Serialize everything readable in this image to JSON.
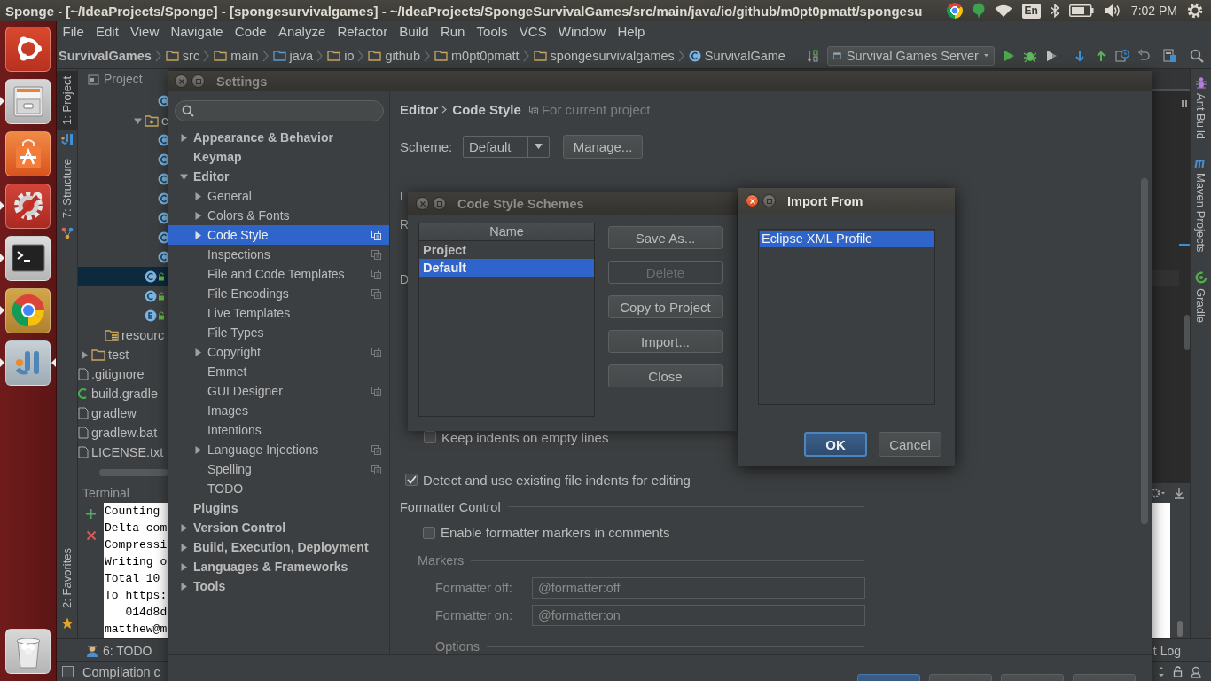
{
  "top_panel": {
    "title": "Sponge - [~/IdeaProjects/Sponge] - [spongesurvivalgames] - ~/IdeaProjects/SpongeSurvivalGames/src/main/java/io/github/m0pt0pmatt/spongesu",
    "keyboard": "En",
    "clock": "7:02 PM"
  },
  "launcher": {
    "apps": [
      {
        "kind": "dash",
        "running": false,
        "focused": false
      },
      {
        "kind": "files",
        "running": true,
        "focused": false
      },
      {
        "kind": "software",
        "running": false,
        "focused": false
      },
      {
        "kind": "settings",
        "running": true,
        "focused": false
      },
      {
        "kind": "terminal",
        "running": true,
        "focused": false
      },
      {
        "kind": "chrome",
        "running": true,
        "focused": false
      },
      {
        "kind": "intellij",
        "running": true,
        "focused": true
      }
    ]
  },
  "menu": [
    "File",
    "Edit",
    "View",
    "Navigate",
    "Code",
    "Analyze",
    "Refactor",
    "Build",
    "Run",
    "Tools",
    "VCS",
    "Window",
    "Help"
  ],
  "navbar": {
    "crumbs": [
      {
        "kind": "module",
        "label": "SurvivalGames"
      },
      {
        "kind": "folder",
        "label": "src"
      },
      {
        "kind": "folder",
        "label": "main"
      },
      {
        "kind": "source-folder",
        "label": "java"
      },
      {
        "kind": "folder",
        "label": "io"
      },
      {
        "kind": "folder",
        "label": "github"
      },
      {
        "kind": "folder",
        "label": "m0pt0pmatt"
      },
      {
        "kind": "folder",
        "label": "spongesurvivalgames"
      },
      {
        "kind": "class",
        "label": "SurvivalGame"
      }
    ],
    "run_config": "Survival Games Server"
  },
  "left_strip": {
    "top": [
      {
        "kind": "project",
        "label": "1: Project",
        "selected": true
      },
      {
        "kind": "structure",
        "label": "7: Structure",
        "selected": false
      }
    ],
    "bottom": [
      {
        "kind": "favorites",
        "label": "2: Favorites",
        "selected": false
      }
    ]
  },
  "right_strip": [
    {
      "kind": "ant",
      "label": "Ant Build"
    },
    {
      "kind": "maven",
      "label": "Maven Projects"
    },
    {
      "kind": "gradle",
      "label": "Gradle"
    }
  ],
  "project": {
    "title": "Project",
    "tree": [
      {
        "children": [
          {
            "children": [
              {
                "children": [
                  {
                    "children": [
                      {
                        "children": [
                          {
                            "children": [
                              {
                                "kind": "class",
                                "selected": false
                              }
                            ]
                          },
                          {
                            "kind": "package",
                            "label": "e",
                            "expanded": true,
                            "selected": false,
                            "children": [
                              {
                                "kind": "class",
                                "selected": false
                              },
                              {
                                "kind": "class",
                                "selected": false
                              },
                              {
                                "kind": "class",
                                "selected": false
                              },
                              {
                                "kind": "class",
                                "selected": false
                              },
                              {
                                "kind": "class",
                                "selected": false
                              },
                              {
                                "kind": "class",
                                "selected": false
                              },
                              {
                                "kind": "class",
                                "selected": false
                              }
                            ]
                          },
                          {
                            "kind": "class-locked",
                            "selected": true
                          },
                          {
                            "kind": "class-locked",
                            "selected": false
                          },
                          {
                            "kind": "enum-locked",
                            "selected": false
                          }
                        ]
                      }
                    ]
                  }
                ]
              },
              {
                "kind": "resources-folder",
                "label": "resourc",
                "selected": false
              }
            ]
          },
          {
            "kind": "folder",
            "label": "test",
            "expanded": false,
            "selected": false
          }
        ]
      },
      {
        "kind": "file",
        "label": ".gitignore",
        "selected": false
      },
      {
        "kind": "gradle-file",
        "label": "build.gradle",
        "selected": false
      },
      {
        "kind": "file",
        "label": "gradlew",
        "selected": false
      },
      {
        "kind": "file",
        "label": "gradlew.bat",
        "selected": false
      },
      {
        "kind": "file",
        "label": "LICENSE.txt",
        "selected": false
      }
    ]
  },
  "terminal": {
    "title": "Terminal",
    "lines": [
      "Counting",
      "Delta com",
      "Compressi",
      "Writing o",
      "Total 10",
      "To https:",
      "   014d8d",
      "matthew@m"
    ]
  },
  "bottom_bar": {
    "left_tabs": [
      "6: TODO"
    ],
    "right_tabs": [
      "t Log"
    ]
  },
  "status_bar": {
    "text": "Compilation c"
  },
  "settings": {
    "title": "Settings",
    "active": false,
    "tree": [
      {
        "label": "Appearance & Behavior",
        "expanded": false,
        "selected": false,
        "per_project": false
      },
      {
        "label": "Keymap",
        "selected": false,
        "per_project": false
      },
      {
        "label": "Editor",
        "expanded": true,
        "selected": false,
        "per_project": false,
        "children": [
          {
            "label": "General",
            "expanded": false,
            "selected": false,
            "per_project": false
          },
          {
            "label": "Colors & Fonts",
            "expanded": false,
            "selected": false,
            "per_project": false
          },
          {
            "label": "Code Style",
            "expanded": false,
            "selected": true,
            "per_project": true
          },
          {
            "label": "Inspections",
            "selected": false,
            "per_project": true
          },
          {
            "label": "File and Code Templates",
            "selected": false,
            "per_project": true
          },
          {
            "label": "File Encodings",
            "selected": false,
            "per_project": true
          },
          {
            "label": "Live Templates",
            "selected": false,
            "per_project": false
          },
          {
            "label": "File Types",
            "selected": false,
            "per_project": false
          },
          {
            "label": "Copyright",
            "expanded": false,
            "selected": false,
            "per_project": true
          },
          {
            "label": "Emmet",
            "selected": false,
            "per_project": false
          },
          {
            "label": "GUI Designer",
            "selected": false,
            "per_project": true
          },
          {
            "label": "Images",
            "selected": false,
            "per_project": false
          },
          {
            "label": "Intentions",
            "selected": false,
            "per_project": false
          },
          {
            "label": "Language Injections",
            "expanded": false,
            "selected": false,
            "per_project": true
          },
          {
            "label": "Spelling",
            "selected": false,
            "per_project": true
          },
          {
            "label": "TODO",
            "selected": false,
            "per_project": false
          }
        ]
      },
      {
        "label": "Plugins",
        "selected": false,
        "per_project": false
      },
      {
        "label": "Version Control",
        "expanded": false,
        "selected": false,
        "per_project": false
      },
      {
        "label": "Build, Execution, Deployment",
        "expanded": false,
        "selected": false,
        "per_project": false
      },
      {
        "label": "Languages & Frameworks",
        "expanded": false,
        "selected": false,
        "per_project": false
      },
      {
        "label": "Tools",
        "expanded": false,
        "selected": false,
        "per_project": false
      }
    ],
    "panel": {
      "breadcrumb": [
        "Editor",
        "Code Style"
      ],
      "scope": "For current project",
      "scheme": {
        "label": "Scheme:",
        "value": "Default"
      },
      "manage": "Manage...",
      "covered_labels": [
        "L",
        "R",
        "D"
      ],
      "keep_indents": {
        "label": "Keep indents on empty lines",
        "checked": false
      },
      "detect_indents": {
        "label": "Detect and use existing file indents for editing",
        "checked": true
      },
      "formatter": {
        "title": "Formatter Control",
        "enable": {
          "label": "Enable formatter markers in comments",
          "checked": false
        },
        "markers_title": "Markers",
        "fields": [
          {
            "label": "Formatter off:",
            "value": "@formatter:off"
          },
          {
            "label": "Formatter on:",
            "value": "@formatter:on"
          }
        ],
        "options_title": "Options"
      }
    },
    "footer_buttons": [
      {
        "default": true
      },
      {
        "default": false
      },
      {
        "default": false
      },
      {
        "default": false
      }
    ]
  },
  "schemes_dialog": {
    "title": "Code Style Schemes",
    "active": false,
    "column": "Name",
    "rows": [
      {
        "label": "Project",
        "selected": false
      },
      {
        "label": "Default",
        "selected": true
      }
    ],
    "buttons": [
      {
        "label": "Save As...",
        "disabled": false
      },
      {
        "label": "Delete",
        "disabled": true
      },
      {
        "label": "Copy to Project",
        "disabled": false
      },
      {
        "label": "Import...",
        "disabled": false
      },
      {
        "label": "Close",
        "disabled": false
      }
    ]
  },
  "import_dialog": {
    "title": "Import From",
    "active": true,
    "items": [
      {
        "label": "Eclipse XML Profile",
        "selected": true
      }
    ],
    "buttons": [
      {
        "label": "OK",
        "default": true
      },
      {
        "label": "Cancel",
        "default": false
      }
    ]
  }
}
